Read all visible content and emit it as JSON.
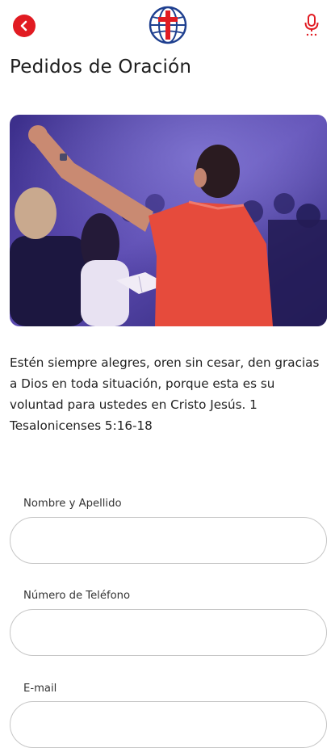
{
  "header": {
    "back_icon": "chevron-left-icon",
    "logo_icon": "globe-cross-logo",
    "mic_icon": "microphone-icon",
    "accent_color": "#e11b22"
  },
  "page": {
    "title": "Pedidos de Oración"
  },
  "hero_image": {
    "description_icon": "worship-photo"
  },
  "verse": {
    "text": "Estén siempre alegres, oren sin cesar, den gracias a Dios en toda situación, porque esta es su voluntad para ustedes en Cristo Jesús. 1 Tesalonicenses 5:16-18"
  },
  "form": {
    "fields": [
      {
        "label": "Nombre y Apellido",
        "value": "",
        "placeholder": ""
      },
      {
        "label": "Número de Teléfono",
        "value": "",
        "placeholder": ""
      },
      {
        "label": "E-mail",
        "value": "",
        "placeholder": ""
      }
    ]
  }
}
